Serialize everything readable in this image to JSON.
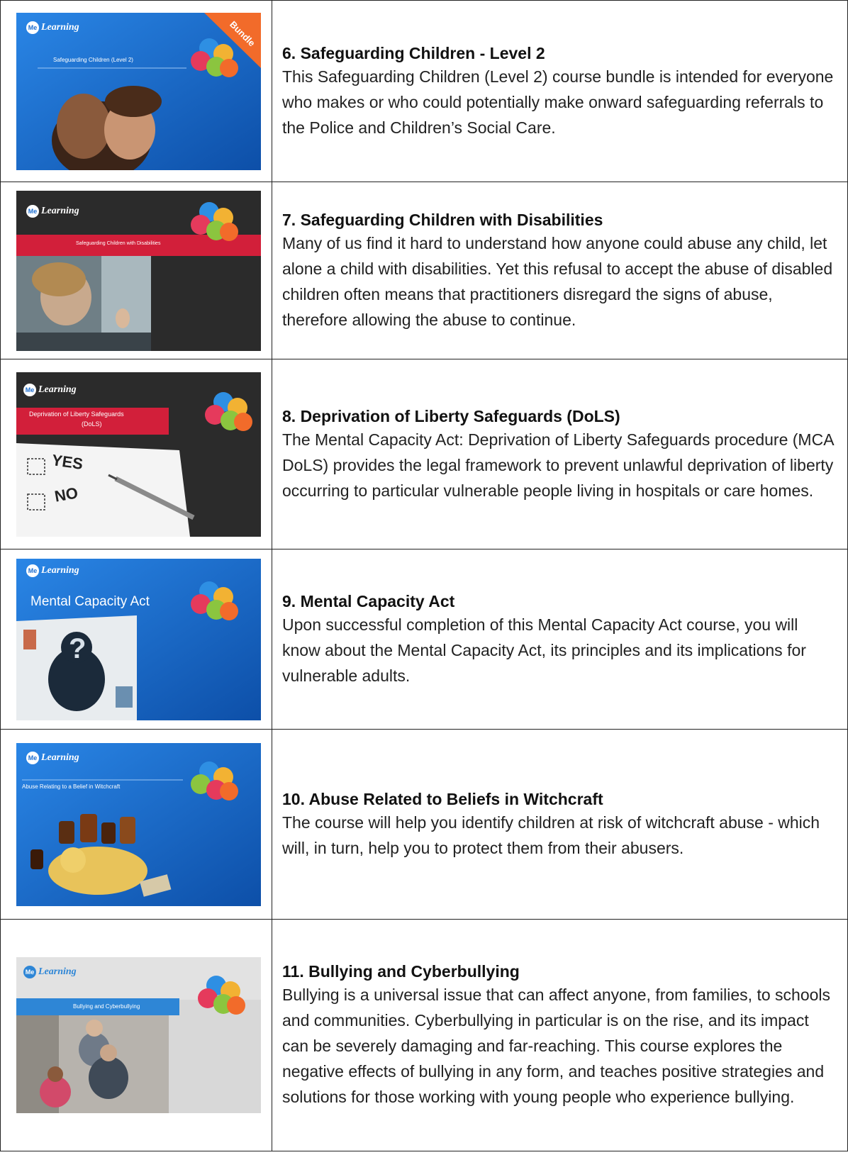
{
  "brand": {
    "logo_text": "Learning",
    "logo_mark": "Me"
  },
  "courses": [
    {
      "title": "6. Safeguarding Children - Level 2",
      "description": "This Safeguarding Children (Level 2) course bundle is intended for everyone who makes or who could potentially make onward safeguarding referrals to the Police and Children’s Social Care.",
      "thumb_label": "Safeguarding Children (Level 2)",
      "thumb_badge": "Bundle",
      "thumb_theme": "#1e6fd0"
    },
    {
      "title": "7. Safeguarding Children with Disabilities",
      "description": "Many of us find it hard to understand how anyone could abuse any child, let alone a child with disabilities. Yet this refusal to accept the abuse of disabled children often means that practitioners disregard the signs of abuse, therefore allowing the abuse to continue.",
      "thumb_label": "Safeguarding Children with Disabilities",
      "thumb_theme": "#2a2a2a"
    },
    {
      "title": "8. Deprivation of Liberty Safeguards (DoLS)",
      "description": "The Mental Capacity Act: Deprivation of Liberty Safeguards procedure (MCA DoLS) provides the legal framework to prevent unlawful deprivation of liberty occurring to particular vulnerable people living in hospitals or care homes.",
      "thumb_label_1": "Deprivation of Liberty Safeguards",
      "thumb_label_2": "(DoLS)",
      "thumb_yes": "YES",
      "thumb_no": "NO",
      "thumb_theme": "#2a2a2a"
    },
    {
      "title": "9. Mental Capacity Act",
      "description": "Upon successful completion of this Mental Capacity Act course, you will know about the Mental Capacity Act, its principles and its implications for vulnerable adults.",
      "thumb_label": "Mental Capacity Act",
      "thumb_theme": "#1e6fd0"
    },
    {
      "title": "10. Abuse Related to Beliefs in Witchcraft",
      "description": "The course will help you identify children at risk of witchcraft abuse - which will, in turn, help you to protect them from their abusers.",
      "thumb_label": "Abuse Relating to a Belief in Witchcraft",
      "thumb_theme": "#1e6fd0"
    },
    {
      "title": "11. Bullying and Cyberbullying",
      "description": "Bullying is a universal issue that can affect anyone, from families, to schools and communities. Cyberbullying in particular is on the rise, and its impact can be severely damaging and far-reaching. This course explores the negative effects of bullying in any form, and teaches positive strategies and solutions for those working with young people who experience bullying.",
      "thumb_label": "Bullying and Cyberbullying",
      "thumb_theme": "#d8d8d8"
    }
  ]
}
